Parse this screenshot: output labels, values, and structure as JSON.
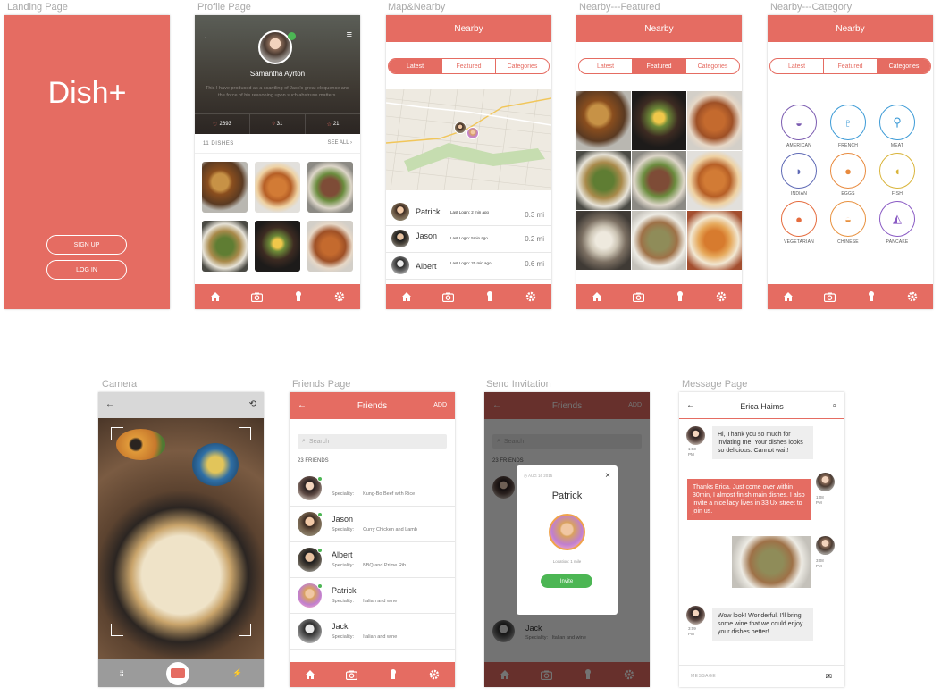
{
  "labels": {
    "landing": "Landing Page",
    "profile": "Profile Page",
    "map": "Map&Nearby",
    "featured": "Nearby---Featured",
    "category": "Nearby---Category",
    "camera": "Camera",
    "friends": "Friends Page",
    "invite": "Send Invitation",
    "message": "Message Page"
  },
  "landing": {
    "logo": "Dish+",
    "signup": "SIGN UP",
    "login": "LOG IN"
  },
  "profile": {
    "name": "Samantha Ayrton",
    "bio": "This I have produced as a scantling of Jack's great eloquence and the force of his reasoning upon such abstruse matters.",
    "stats": [
      "2693",
      "31",
      "21"
    ],
    "dish_count": "11 DISHES",
    "see_all": "SEE ALL"
  },
  "nearby": {
    "title": "Nearby",
    "tabs": [
      "Latest",
      "Featured",
      "Categories"
    ],
    "people": [
      {
        "name": "Patrick",
        "last": "Last Login: 2 min ago",
        "dist": "0.3 mi"
      },
      {
        "name": "Jason",
        "last": "Last Login: 5min ago",
        "dist": "0.2 mi"
      },
      {
        "name": "Albert",
        "last": "Last Login: 20 min ago",
        "dist": "0.6 mi"
      }
    ]
  },
  "categories": [
    {
      "name": "AMERICAN",
      "color": "#7b5bb0"
    },
    {
      "name": "FRENCH",
      "color": "#3b9ad6"
    },
    {
      "name": "MEAT",
      "color": "#3b9ad6"
    },
    {
      "name": "INDIAN",
      "color": "#5f6ab5"
    },
    {
      "name": "EGGS",
      "color": "#e88a3e"
    },
    {
      "name": "FISH",
      "color": "#d9b43a"
    },
    {
      "name": "VEGETARIAN",
      "color": "#e56c3e"
    },
    {
      "name": "CHINESE",
      "color": "#e8913e"
    },
    {
      "name": "PANCAKE",
      "color": "#8a5bc4"
    }
  ],
  "friends": {
    "title": "Friends",
    "add": "ADD",
    "search_placeholder": "Search",
    "count": "23 FRIENDS",
    "spec_label": "Speciality:",
    "list": [
      {
        "name": "",
        "spec": "Kung-Bo Beef with Rice"
      },
      {
        "name": "Jason",
        "spec": "Curry Chicken and Lamb"
      },
      {
        "name": "Albert",
        "spec": "BBQ and Prime Rib"
      },
      {
        "name": "Patrick",
        "spec": "Italian and wine"
      },
      {
        "name": "Jack",
        "spec": "Italian and wine"
      }
    ]
  },
  "invite": {
    "date": "AUG 16 2015",
    "name": "Patrick",
    "location": "Location: 1 mile",
    "button": "Invite",
    "close": "×"
  },
  "message": {
    "title": "Erica Haims",
    "input_placeholder": "MESSAGE",
    "bubbles": [
      {
        "text": "Hi, Thank you so much for inviating me! Your dishes looks so delicious. Cannot wait!",
        "time": "1:03 PM"
      },
      {
        "text": "Thanks Erica. Just come over within 30min, I almost finish main dishes. I also invite a nice lady lives in 33 Ux street to join us.",
        "time": "1:08 PM"
      },
      {
        "text": "",
        "time": "3:08 PM"
      },
      {
        "text": "Wow look! Wonderful. I'll bring some wine that we could enjoy your dishes better!",
        "time": "3:09 PM"
      }
    ]
  },
  "colors": {
    "accent": "#e56c62",
    "invite_green": "#4cb654"
  }
}
